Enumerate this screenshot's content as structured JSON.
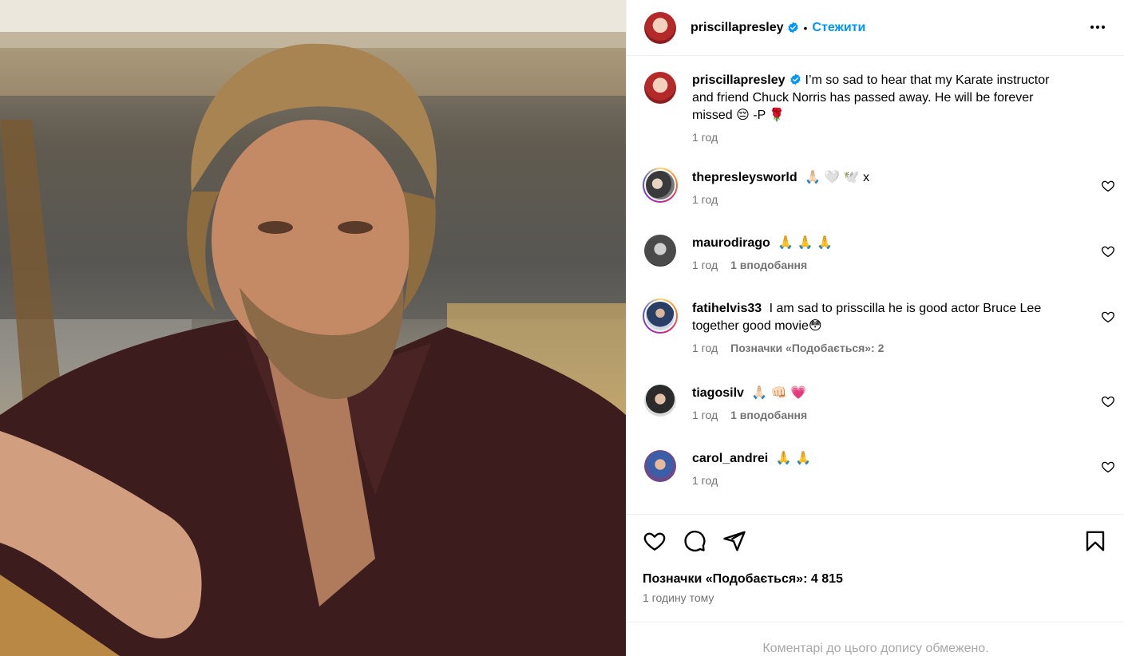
{
  "post": {
    "photo_alt": "",
    "author": {
      "username": "priscillapresley",
      "verified": true,
      "follow_label": "Стежити",
      "dot": "•"
    },
    "caption": {
      "username": "priscillapresley",
      "text": "I’m so sad to hear that my Karate instructor and friend Chuck Norris has passed away. He will be forever missed 😔  -P 🌹",
      "time": "1 год"
    },
    "comments": [
      {
        "username": "thepresleysworld",
        "text": "🙏🏻 🤍 🕊️ x",
        "time": "1 год",
        "likes": "",
        "story_ring": true
      },
      {
        "username": "maurodirago",
        "text": "🙏 🙏 🙏",
        "time": "1 год",
        "likes": "1 вподобання",
        "story_ring": false
      },
      {
        "username": "fatihelvis33",
        "text": "I am sad to prisscilla he is good actor Bruce Lee together good movie😳",
        "time": "1 год",
        "likes": "Позначки «Подобається»: 2",
        "story_ring": true
      },
      {
        "username": "tiagosilv",
        "text": "🙏🏻 👊🏻 💗",
        "time": "1 год",
        "likes": "1 вподобання",
        "story_ring": false
      },
      {
        "username": "carol_andrei",
        "text": "🙏 🙏",
        "time": "1 год",
        "likes": "",
        "story_ring": false
      }
    ],
    "actions": {
      "like_icon": "heart-icon",
      "comment_icon": "comment-icon",
      "share_icon": "share-icon",
      "save_icon": "bookmark-icon"
    },
    "likes_label": "Позначки «Подобається»: 4 815",
    "time_full": "1 годину тому",
    "comments_closed": "Коментарі до цього допису обмежено."
  },
  "colors": {
    "link_blue": "#0095f6",
    "secondary_text": "#737373",
    "divider": "#efefef",
    "verified_blue": "#0095f6"
  }
}
